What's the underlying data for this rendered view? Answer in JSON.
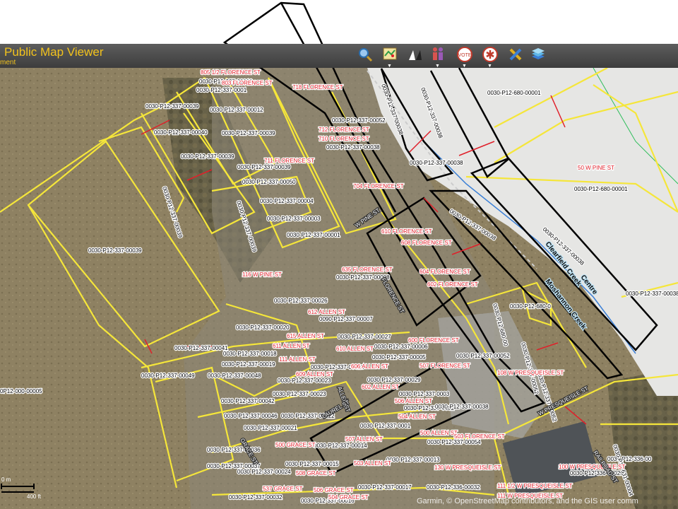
{
  "app": {
    "title": "Public Map Viewer",
    "subtitle": "ment"
  },
  "toolbar": {
    "tools": [
      {
        "icon": "magnifier-icon"
      },
      {
        "icon": "map-layers-icon"
      },
      {
        "icon": "measure-icon"
      },
      {
        "icon": "people-icon"
      },
      {
        "icon": "vote-icon"
      },
      {
        "icon": "emergency-icon"
      },
      {
        "icon": "tools-icon"
      },
      {
        "icon": "basemap-stack-icon"
      }
    ]
  },
  "colors": {
    "parcel_line": "#f5e63a",
    "highlight_line": "#000000",
    "parcel_id_text": "#000000",
    "address_text": "#e0202a",
    "title": "#f2c21c",
    "river": "#3a7fd6"
  },
  "scale_bar": {
    "metric": "0 m",
    "imperial": "400 ft"
  },
  "attribution": "Garmin, © OpenStreetMap contributors, and the GIS user comm",
  "parcel_ids": [
    "0030-P12-337-00010",
    "0030-P12-337-0001",
    "0030-P12-337-00039",
    "0030-P12-337-00012",
    "0030-P12-337-00040",
    "0030-P12-337-00039",
    "0030-P12-337-00039",
    "0030-P12-337-00039",
    "0030-P12-337-00050",
    "0030-P12-337-00004",
    "0030-P12-337-00003",
    "0030-P12-337-00001",
    "0030-P12-337-00039",
    "0030-P12-337-00039",
    "0030-P12-337-00039",
    "0030-P12-337-00052",
    "0030-P12-337-00038",
    "0030-P12-337-00038",
    "0030-P12-337-00038",
    "0030-P12-337-00038",
    "0030-P12-680-00001",
    "0030-P12-680-00001",
    "0030-P12-337-00038",
    "0030-P12-337-00038",
    "0030-P12-337-00038",
    "0030-P12-680-0",
    "0030-P12-337-00008",
    "0030-P12-337-00026",
    "0090-P12-337-00007",
    "0030-P12-680-00",
    "0030-P12-337-00052",
    "0030-P12-337-00020",
    "0030-P12-337-00027",
    "0030-P12-337-00006",
    "0030-P12-337-00041",
    "0030-P12-337-00018",
    "0030-P12-337-00005",
    "0030-P12-337-00052",
    "0030-P12-337-00019",
    "0030-P12-337-00028",
    "0030-P12-337-00049",
    "0030-P12-337-00048",
    "0030-P12-337-00023",
    "0030-P12-337-00029",
    "0030-P12-337-00052",
    "0P12-000-00005",
    "0030-P12-337-00023",
    "0030-P12-337-0003",
    "0030-P12-337-00042",
    "0030-P12-337-00046",
    "0030-P12-337-00022",
    "0030-P12-337-0002",
    "0030-P12-337-00038",
    "0030-P12-337-00021",
    "0030-P12-337-0001",
    "0030-P12-337-00014",
    "0030-P12-337-00054",
    "0030-P12-337-00036",
    "0030-P12-337-00015",
    "0030-P12-337-00013",
    "0030-P12-337-00037",
    "0030-P12-337-00024",
    "0030-P12-337-00017",
    "0030-P12-336-00032",
    "0030-P12-336-00",
    "0030-P12-336-00029",
    "0030-P12-631-00004",
    "0030-P12-337-00032",
    "0030-P12-337-00016"
  ],
  "addresses": [
    "805 1/2 FLORENCE ST",
    "803 FLORENCE ST",
    "718 FLORENCE ST",
    "712 FLORENCE ST",
    "710 FLORENCE ST",
    "711 FLORENCE ST",
    "704 FLORENCE ST",
    "50 W PINE ST",
    "610 FLORENCE ST",
    "608 FLORENCE ST",
    "604 FLORENCE ST",
    "602 FLORENCE ST",
    "635 FLORENCE ST",
    "116 W PINE ST",
    "612 ALLEN ST",
    "615 ALLEN ST",
    "611 ALLEN ST",
    "610 ALLEN ST",
    "600 FLORENCE ST",
    "507 FLORENCE ST",
    "609 ALLEN ST",
    "606 ALLEN ST",
    "111 ALLEN ST",
    "108 W PRESQUEISLE ST",
    "602 ALLEN ST",
    "506 ALLEN ST",
    "504 ALLEN ST",
    "500 ALLEN ST",
    "503 FLORENCE ST",
    "507 ALLEN ST",
    "500 GRACE ST",
    "503 ALLEN ST",
    "130 W PRESQUEISLE ST",
    "100 W PRESQUEISLE ST",
    "111 1/2 W PRESQUEISLE ST",
    "111 W PRESQUEISLE ST",
    "537 GRACE ST",
    "506 GRACE ST",
    "508 GRACE ST",
    "504 GRACE ST"
  ],
  "street_labels": [
    "W PINE ST",
    "FLORENCE ST",
    "W PRESQUEISLE ST",
    "ALLEN ST",
    "RAILROAD ST",
    "LAUREL ST",
    "GRACE ST"
  ],
  "waterway_labels": [
    "Clearfield Creek",
    "Moshannon Creek",
    "Centre"
  ]
}
